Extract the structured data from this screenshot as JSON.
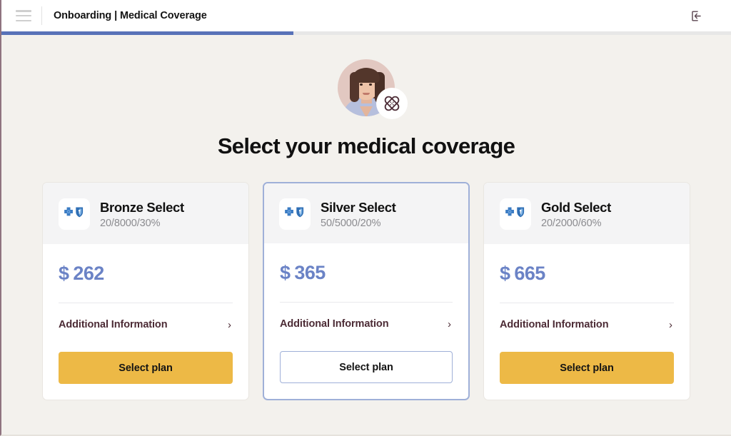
{
  "topbar": {
    "menu_icon": "hamburger-menu-icon",
    "title": "Onboarding | Medical Coverage",
    "logout_icon": "logout-icon"
  },
  "progress": {
    "percent": 40,
    "fill_color": "#5872b8",
    "track_color": "#e7e7e7"
  },
  "hero": {
    "avatar_alt": "person-avatar",
    "badge_icon": "bandage-icon"
  },
  "main": {
    "title": "Select your medical coverage"
  },
  "colors": {
    "page_background": "#f3f1ed",
    "price": "#6b83c6",
    "primary_button": "#edb946",
    "selected_border": "#9fb0d8",
    "link_text": "#4c2b35"
  },
  "plans": [
    {
      "name": "Bronze Select",
      "code": "20/8000/30%",
      "logo_icon": "blue-cross-blue-shield-logo",
      "currency": "$",
      "price": "262",
      "additional_label": "Additional Information",
      "chevron_icon": "chevron-right-icon",
      "button_label": "Select plan",
      "button_style": "primary",
      "selected": false
    },
    {
      "name": "Silver Select",
      "code": "50/5000/20%",
      "logo_icon": "blue-cross-blue-shield-logo",
      "currency": "$",
      "price": "365",
      "additional_label": "Additional Information",
      "chevron_icon": "chevron-right-icon",
      "button_label": "Select plan",
      "button_style": "outline",
      "selected": true
    },
    {
      "name": "Gold Select",
      "code": "20/2000/60%",
      "logo_icon": "blue-cross-blue-shield-logo",
      "currency": "$",
      "price": "665",
      "additional_label": "Additional Information",
      "chevron_icon": "chevron-right-icon",
      "button_label": "Select plan",
      "button_style": "primary",
      "selected": false
    }
  ]
}
